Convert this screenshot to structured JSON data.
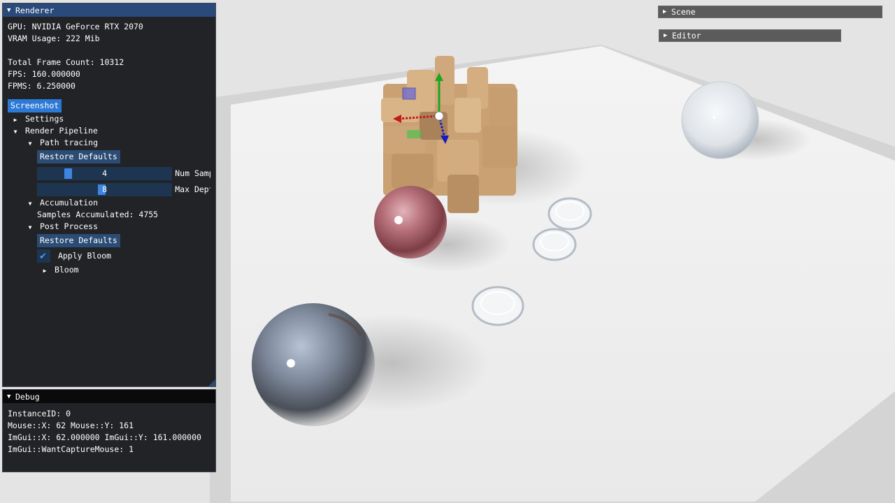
{
  "renderer": {
    "title": "Renderer",
    "gpu": "GPU: NVIDIA GeForce RTX 2070",
    "vram": "VRAM Usage: 222 Mib",
    "frame_count": "Total Frame Count: 10312",
    "fps": "FPS: 160.000000",
    "fpms": "FPMS: 6.250000",
    "screenshot_button": "Screenshot",
    "settings": "Settings",
    "render_pipeline": "Render Pipeline",
    "path_tracing": "Path tracing",
    "restore_defaults_1": "Restore Defaults",
    "num_samples": {
      "value": "4",
      "label": "Num Samples",
      "fraction": 0.2
    },
    "max_depth": {
      "value": "8",
      "label": "Max Depth",
      "fraction": 0.47
    },
    "accumulation": "Accumulation",
    "samples_accumulated": "Samples Accumulated: 4755",
    "post_process": "Post Process",
    "restore_defaults_2": "Restore Defaults",
    "apply_bloom": {
      "label": "Apply Bloom",
      "checked": true
    },
    "bloom": "Bloom"
  },
  "debug": {
    "title": "Debug",
    "instance_id": "InstanceID: 0",
    "mouse": "Mouse::X: 62 Mouse::Y: 161",
    "imgui_mouse": "ImGui::X: 62.000000 ImGui::Y: 161.000000",
    "want_capture": "ImGui::WantCaptureMouse: 1"
  },
  "scene_header": "Scene",
  "editor_header": "Editor",
  "colors": {
    "title_active": "#294a7a",
    "button": "#2d7ad6",
    "slider_grab": "#3d85e0",
    "window_bg": "#14161a"
  }
}
